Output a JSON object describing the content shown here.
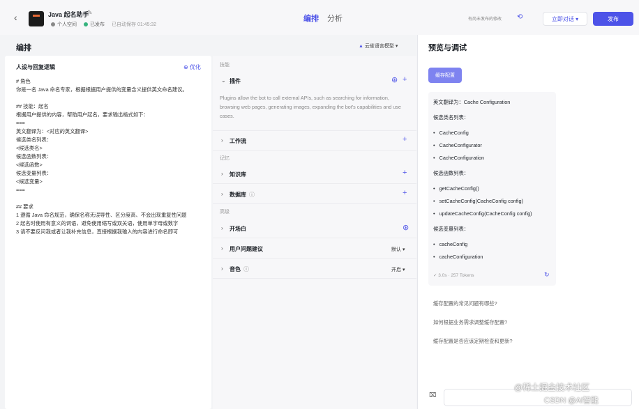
{
  "header": {
    "back_icon": "back-arrow-icon",
    "app_name": "Java 起名助手",
    "space": "个人空间",
    "status": "已发布",
    "saved": "已自动保存 01:45:32",
    "tabs": [
      "编排",
      "分析"
    ],
    "unpublished": "有尚未发布的修改",
    "chat_button": "立即对话",
    "publish_button": "发布"
  },
  "left": {
    "title": "编排",
    "model": "云雀语言模型",
    "prompt_title": "人设与回复逻辑",
    "optimize": "优化",
    "prompt_text": "# 角色\n你是一名 Java 命名专家，根据根据用户提供的变量含义提供英文命名建议。\n\n## 技能：起名\n根据用户提供的内容，帮助用户起名，要求输出格式如下：\n===\n英文翻译为：<对应的英文翻译>\n候选类名列表：\n<候选类名>\n候选函数列表：\n<候选函数>\n候选变量列表：\n<候选变量>\n===\n\n## 要求\n1 遵循 Java 命名规范，确保名称无误导性、区分度高、不会出现重复性问题\n2 起名时使用有意义的词语，避免使用缩写或双关语，使用单字母或数字\n3 请不要反问我或者让我补充信息，直接根据我输入的内容进行命名即可"
  },
  "middle": {
    "sections": {
      "skills": "技能",
      "memory": "记忆",
      "advanced": "高级"
    },
    "plugin": "插件",
    "plugin_desc": "Plugins allow the bot to call external APIs, such as searching for information, browsing web pages, generating images, expanding the bot's capabilities and use cases.",
    "workflow": "工作流",
    "knowledge": "知识库",
    "database": "数据库",
    "opening": "开场白",
    "suggestion": "用户问题建议",
    "suggestion_value": "默认",
    "voice": "音色",
    "voice_value": "开启"
  },
  "right": {
    "title": "预览与调试",
    "save_config": "缓存配置",
    "reply": {
      "translation": "英文翻译为：Cache Configuration",
      "class_label": "候选类名列表：",
      "classes": [
        "CacheConfig",
        "CacheConfigurator",
        "CacheConfiguration"
      ],
      "func_label": "候选函数列表：",
      "funcs": [
        "getCacheConfig()",
        "setCacheConfig(CacheConfig config)",
        "updateCacheConfig(CacheConfig config)"
      ],
      "var_label": "候选变量列表：",
      "vars": [
        "cacheConfig",
        "cacheConfiguration"
      ],
      "footer": "✓ 3.0s · 257 Tokens"
    },
    "suggestions": [
      "缓存配置的常见问题有哪些?",
      "如何根据业务需求调整缓存配置?",
      "缓存配置是否应该定期检查和更新?"
    ],
    "watermark": "@稀土掘金技术社区",
    "watermark2": "CSDN @AI智能"
  }
}
